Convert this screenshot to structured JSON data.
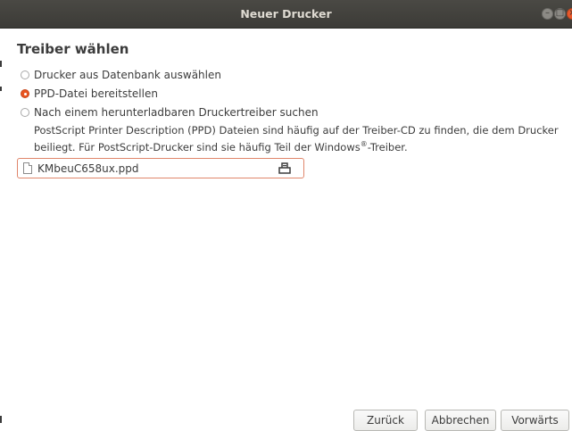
{
  "window": {
    "title": "Neuer Drucker",
    "controls": {
      "minimize_icon": "minimize-icon",
      "maximize_icon": "maximize-icon",
      "close_icon": "close-icon"
    }
  },
  "page": {
    "heading": "Treiber wählen",
    "options": [
      {
        "label": "Drucker aus Datenbank auswählen",
        "selected": false
      },
      {
        "label": "PPD-Datei bereitstellen",
        "selected": true
      },
      {
        "label": "Nach einem herunterladbaren Druckertreiber suchen",
        "selected": false
      }
    ],
    "description": {
      "line1": "PostScript Printer Description (PPD) Dateien sind häufig auf der Treiber-CD zu finden, die dem Drucker",
      "line2_prefix": "beiliegt. Für PostScript-Drucker sind sie häufig Teil der Windows",
      "registered": "®",
      "line2_suffix": "-Treiber."
    },
    "file_chooser": {
      "value": "KMbeuC658ux.ppd",
      "file_icon": "document-icon",
      "open_icon": "folder-open-icon"
    }
  },
  "buttons": {
    "back": "Zurück",
    "cancel": "Abbrechen",
    "forward": "Vorwärts"
  },
  "colors": {
    "accent": "#e95420",
    "titlebar": "#3c3b37",
    "text": "#3c3c3c"
  }
}
